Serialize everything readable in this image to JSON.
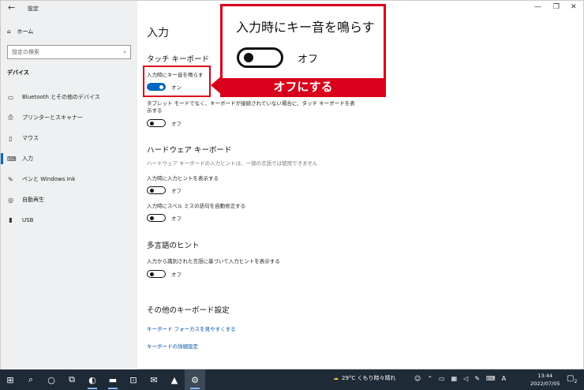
{
  "window": {
    "title": "設定",
    "back_icon": "←",
    "minimize": "—",
    "restore": "❐",
    "close": "✕"
  },
  "sidebar": {
    "home": "ホーム",
    "search_placeholder": "設定の検索",
    "section": "デバイス",
    "items": [
      {
        "label": "Bluetooth とその他のデバイス",
        "icon": "bluetooth-icon"
      },
      {
        "label": "プリンターとスキャナー",
        "icon": "printer-icon"
      },
      {
        "label": "マウス",
        "icon": "mouse-icon"
      },
      {
        "label": "入力",
        "icon": "keyboard-icon"
      },
      {
        "label": "ペンと Windows Ink",
        "icon": "pen-icon"
      },
      {
        "label": "自動再生",
        "icon": "autoplay-icon"
      },
      {
        "label": "USB",
        "icon": "usb-icon"
      }
    ],
    "active_index": 3
  },
  "main": {
    "title": "入力",
    "touch_keyboard": {
      "heading": "タッチ キーボード",
      "key_sound_label": "入力時にキー音を鳴らす",
      "key_sound_state": "オン",
      "no_keyboard_label_line1": "タブレット モードでなく、キーボードが接続されていない場合に、タッチ キーボードを表",
      "no_keyboard_label_line2": "示する",
      "no_keyboard_state": "オフ"
    },
    "hardware_keyboard": {
      "heading": "ハードウェア キーボード",
      "desc": "ハードウェア キーボードの入力ヒントは、一部の言語では使用できません",
      "hint_label": "入力時に入力ヒントを表示する",
      "hint_state": "オフ",
      "autocorrect_label": "入力時にスペル ミスの語句を自動修正する",
      "autocorrect_state": "オフ"
    },
    "multilingual": {
      "heading": "多言語のヒント",
      "label": "入力から識別された言語に基づいて入力ヒントを表示する",
      "state": "オフ"
    },
    "other": {
      "heading": "その他のキーボード設定",
      "link1": "キーボード フォーカスを見やすくする",
      "link2": "キーボードの詳細設定"
    }
  },
  "annotation": {
    "zoom_title": "入力時にキー音を鳴らす",
    "zoom_state": "オフ",
    "callout": "オフにする",
    "color": "#d9001b"
  },
  "taskbar": {
    "weather": "29°C くもり時々晴れ",
    "ime": "A",
    "time": "13:44",
    "date": "2022/07/05",
    "notifications": "2"
  },
  "colors": {
    "accent": "#0067c0",
    "sidebar_bg": "#eef0f1",
    "taskbar_bg": "#1e2a36"
  }
}
